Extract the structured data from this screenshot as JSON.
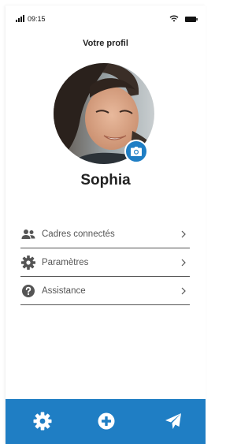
{
  "status_bar": {
    "time": "09:15",
    "signal_icon": "cellular-signal-icon",
    "wifi_icon": "wifi-icon",
    "battery_icon": "battery-icon"
  },
  "header": {
    "title": "Votre profil"
  },
  "profile": {
    "name": "Sophia",
    "camera_icon": "camera-icon"
  },
  "menu": {
    "items": [
      {
        "label": "Cadres connectés",
        "icon": "users-icon"
      },
      {
        "label": "Paramètres",
        "icon": "gear-icon"
      },
      {
        "label": "Assistance",
        "icon": "help-circle-icon"
      }
    ]
  },
  "tab_bar": {
    "items": [
      {
        "icon": "gear-icon"
      },
      {
        "icon": "plus-circle-icon"
      },
      {
        "icon": "paper-plane-icon"
      }
    ]
  },
  "colors": {
    "accent": "#1f7ec4",
    "text": "#222222",
    "muted_text": "#555555"
  }
}
